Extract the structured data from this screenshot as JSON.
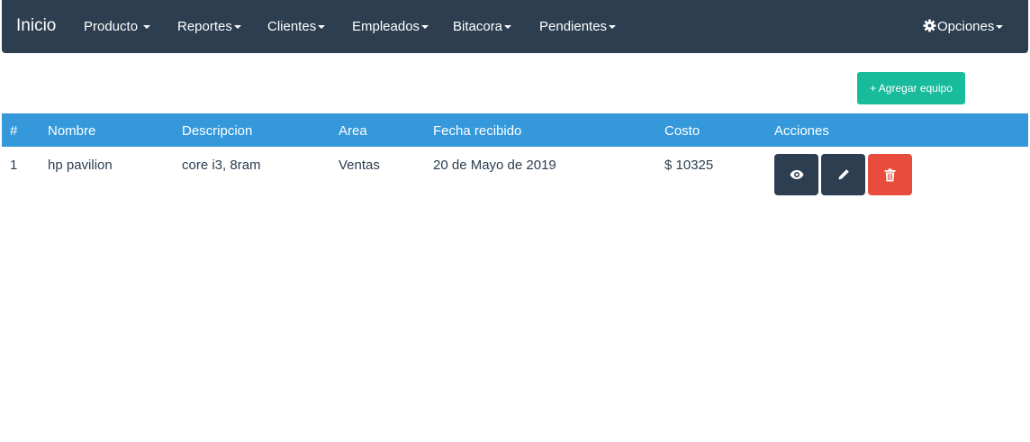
{
  "navbar": {
    "brand": "Inicio",
    "items": [
      {
        "label": "Producto"
      },
      {
        "label": "Reportes"
      },
      {
        "label": "Clientes"
      },
      {
        "label": "Empleados"
      },
      {
        "label": "Bitacora"
      },
      {
        "label": "Pendientes"
      }
    ],
    "options_label": "Opciones",
    "colors": {
      "background": "#2c3e50"
    }
  },
  "toolbar": {
    "add_label": "+ Agregar equipo",
    "add_color": "#18bc9c"
  },
  "table": {
    "header_color": "#3498db",
    "columns": [
      "#",
      "Nombre",
      "Descripcion",
      "Area",
      "Fecha recibido",
      "Costo",
      "Acciones"
    ],
    "rows": [
      {
        "id": "1",
        "nombre": "hp pavilion",
        "descripcion": "core i3, 8ram",
        "area": "Ventas",
        "fecha": "20 de Mayo de 2019",
        "costo": "$ 10325",
        "actions": [
          {
            "icon": "eye-icon",
            "color": "#2c3e50"
          },
          {
            "icon": "pencil-icon",
            "color": "#2c3e50"
          },
          {
            "icon": "trash-icon",
            "color": "#e74c3c"
          }
        ]
      }
    ]
  }
}
